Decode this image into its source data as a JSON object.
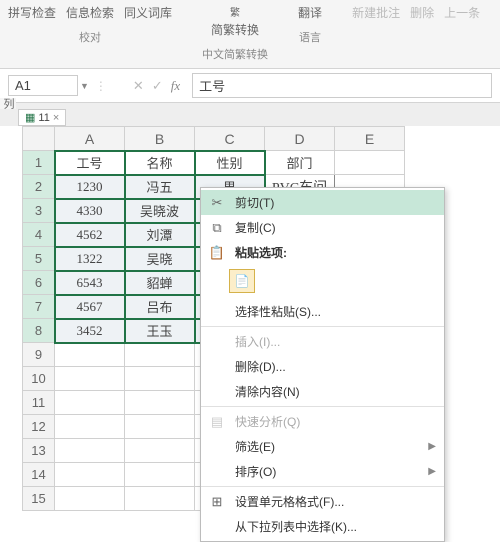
{
  "ribbon": {
    "spell": "拼写检查",
    "info": "信息检索",
    "thes": "同义词库",
    "group_proof": "校对",
    "conv1": "简繁转换",
    "conv2": "中文简繁转换",
    "translate": "翻译",
    "group_lang": "语言",
    "new_comment": "新建批注",
    "delete": "删除",
    "prev": "上一条"
  },
  "namebox": {
    "value": "A1"
  },
  "formula": {
    "value": "工号"
  },
  "tab": {
    "label": "11"
  },
  "headers": {
    "A": "A",
    "B": "B",
    "C": "C",
    "D": "D",
    "E": "E"
  },
  "table": {
    "head": {
      "c1": "工号",
      "c2": "名称",
      "c3": "性别",
      "c4": "部门"
    },
    "rows": [
      {
        "n": "1"
      },
      {
        "n": "2",
        "c1": "1230",
        "c2": "冯五",
        "c3": "男",
        "c4": "PVC车间"
      },
      {
        "n": "3",
        "c1": "4330",
        "c2": "吴晓波"
      },
      {
        "n": "4",
        "c1": "4562",
        "c2": "刘潭"
      },
      {
        "n": "5",
        "c1": "1322",
        "c2": "吴晓"
      },
      {
        "n": "6",
        "c1": "6543",
        "c2": "貂蝉"
      },
      {
        "n": "7",
        "c1": "4567",
        "c2": "吕布"
      },
      {
        "n": "8",
        "c1": "3452",
        "c2": "王玉"
      },
      {
        "n": "9"
      },
      {
        "n": "10"
      },
      {
        "n": "11"
      },
      {
        "n": "12"
      },
      {
        "n": "13"
      },
      {
        "n": "14"
      },
      {
        "n": "15"
      }
    ]
  },
  "menu": {
    "cut": "剪切(T)",
    "copy": "复制(C)",
    "paste_opts": "粘贴选项:",
    "paste_special": "选择性粘贴(S)...",
    "insert": "插入(I)...",
    "delete": "删除(D)...",
    "clear": "清除内容(N)",
    "quick": "快速分析(Q)",
    "filter": "筛选(E)",
    "sort": "排序(O)",
    "format": "设置单元格格式(F)...",
    "dropdown": "从下拉列表中选择(K)..."
  },
  "side": "列"
}
